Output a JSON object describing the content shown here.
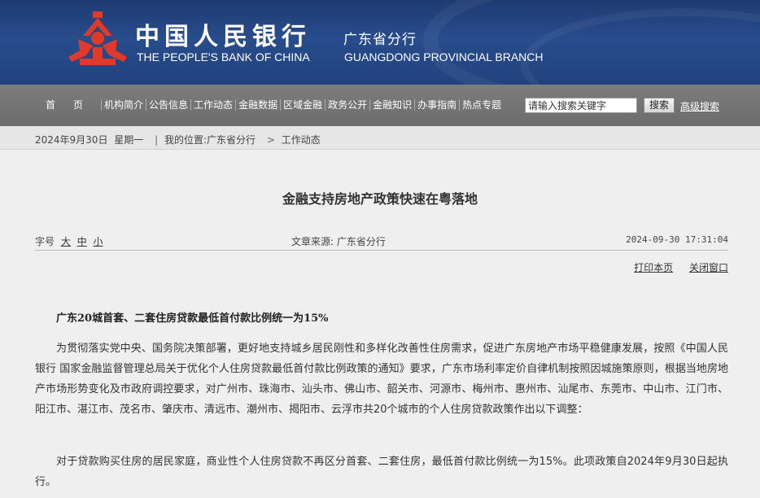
{
  "header": {
    "bank_name_cn": "中国人民银行",
    "branch_cn": "广东省分行",
    "bank_name_en": "THE PEOPLE'S BANK OF CHINA",
    "branch_en": "GUANGDONG PROVINCIAL BRANCH",
    "logo_icon": "pboc-logo-icon",
    "colors": {
      "header_bg": "#284c8c",
      "logo_red": "#e03a2a",
      "nav_bg": "#747474"
    }
  },
  "nav": {
    "items": [
      {
        "label": "首页"
      },
      {
        "label": "机构简介"
      },
      {
        "label": "公告信息"
      },
      {
        "label": "工作动态"
      },
      {
        "label": "金融数据"
      },
      {
        "label": "区域金融"
      },
      {
        "label": "政务公开"
      },
      {
        "label": "金融知识"
      },
      {
        "label": "办事指南"
      },
      {
        "label": "热点专题"
      }
    ],
    "search_placeholder": "请输入搜索关键字",
    "search_button": "搜索",
    "advanced_search": "高级搜索"
  },
  "breadcrumb": {
    "date": "2024年9月30日",
    "weekday": "星期一",
    "location_label": "我的位置:",
    "crumb1": "广东省分行",
    "crumb2": "工作动态",
    "separator": ">",
    "divider": "|"
  },
  "article": {
    "title": "金融支持房地产政策快速在粤落地",
    "font_label": "字号",
    "font_large": "大",
    "font_medium": "中",
    "font_small": "小",
    "source": "文章来源: 广东省分行",
    "datetime": "2024-09-30 17:31:04",
    "print_label": "打印本页",
    "close_label": "关闭窗口",
    "subheading": "广东20城首套、二套住房贷款最低首付款比例统一为15%",
    "paragraph1": "为贯彻落实党中央、国务院决策部署，更好地支持城乡居民刚性和多样化改善性住房需求，促进广东房地产市场平稳健康发展，按照《中国人民银行 国家金融监督管理总局关于优化个人住房贷款最低首付款比例政策的通知》要求，广东市场利率定价自律机制按照因城施策原则，根据当地房地产市场形势变化及市政府调控要求，对广州市、珠海市、汕头市、佛山市、韶关市、河源市、梅州市、惠州市、汕尾市、东莞市、中山市、江门市、阳江市、湛江市、茂名市、肇庆市、清远市、潮州市、揭阳市、云浮市共20个城市的个人住房贷款政策作出以下调整：",
    "paragraph2": "对于贷款购买住房的居民家庭，商业性个人住房贷款不再区分首套、二套住房，最低首付款比例统一为15%。此项政策自2024年9月30日起执行。"
  }
}
